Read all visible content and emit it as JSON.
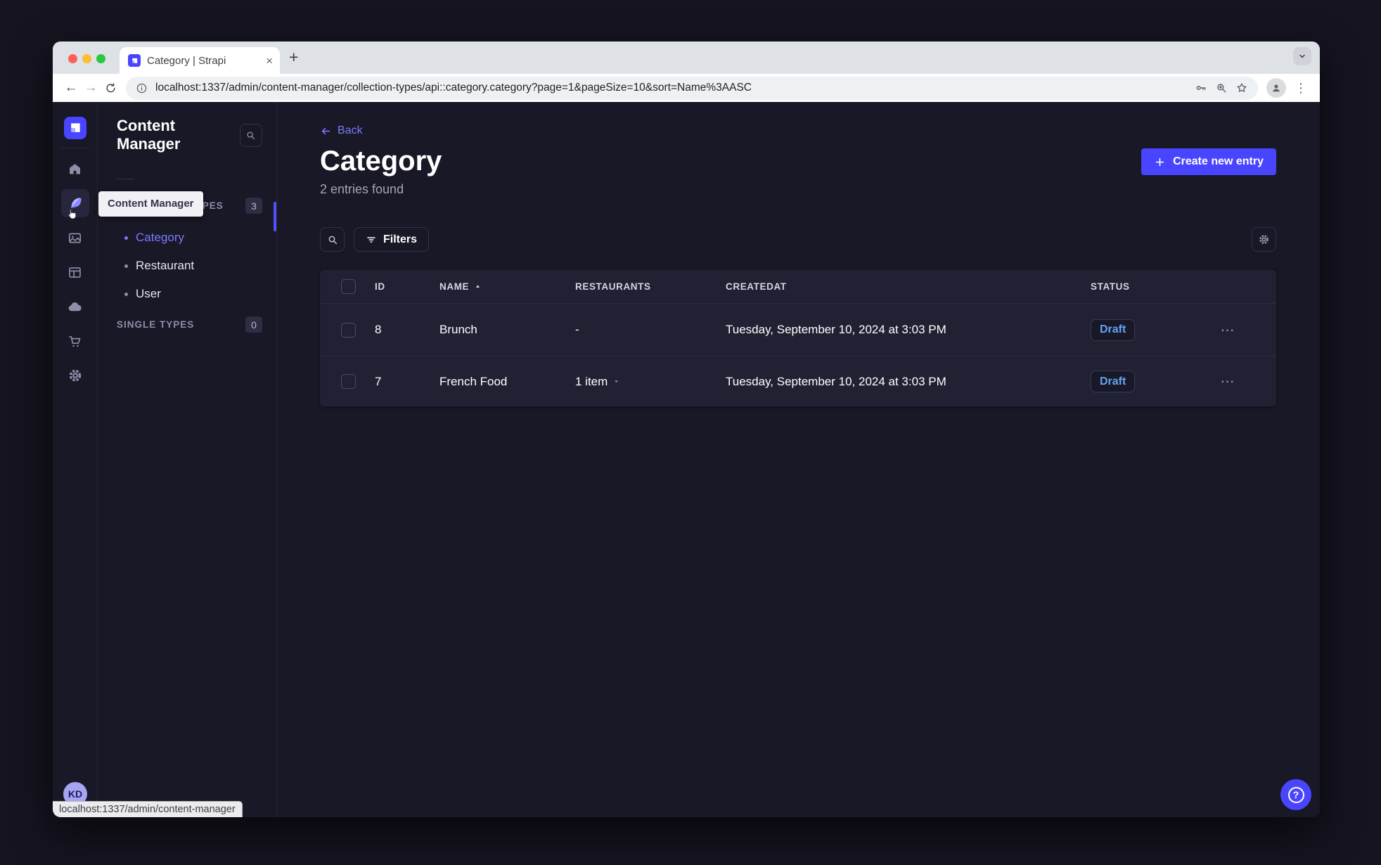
{
  "browser": {
    "tab_title": "Category | Strapi",
    "url": "localhost:1337/admin/content-manager/collection-types/api::category.category?page=1&pageSize=10&sort=Name%3AASC",
    "status_tooltip": "localhost:1337/admin/content-manager"
  },
  "rail": {
    "tooltip": "Content Manager",
    "avatar_initials": "KD"
  },
  "sidebar": {
    "title": "Content Manager",
    "collection_types": {
      "label": "COLLECTION TYPES",
      "badge": "3",
      "items": [
        {
          "label": "Category",
          "active": true
        },
        {
          "label": "Restaurant",
          "active": false
        },
        {
          "label": "User",
          "active": false
        }
      ]
    },
    "single_types": {
      "label": "SINGLE TYPES",
      "badge": "0"
    }
  },
  "main": {
    "back_label": "Back",
    "title": "Category",
    "subtitle": "2 entries found",
    "create_button_label": "Create new entry",
    "filters_label": "Filters"
  },
  "table": {
    "headers": {
      "id": "ID",
      "name": "NAME",
      "restaurants": "RESTAURANTS",
      "created_at": "CREATEDAT",
      "status": "STATUS"
    },
    "sort": {
      "column": "NAME",
      "direction": "asc"
    },
    "rows": [
      {
        "id": "8",
        "name": "Brunch",
        "restaurants": "-",
        "created_at": "Tuesday, September 10, 2024 at 3:03 PM",
        "status": "Draft"
      },
      {
        "id": "7",
        "name": "French Food",
        "restaurants": "1 item",
        "created_at": "Tuesday, September 10, 2024 at 3:03 PM",
        "status": "Draft"
      }
    ]
  },
  "colors": {
    "primary": "#4945ff",
    "primary_light": "#7b79ff",
    "draft_text": "#66a3f5",
    "card_bg": "#212134",
    "page_bg": "#181826"
  }
}
